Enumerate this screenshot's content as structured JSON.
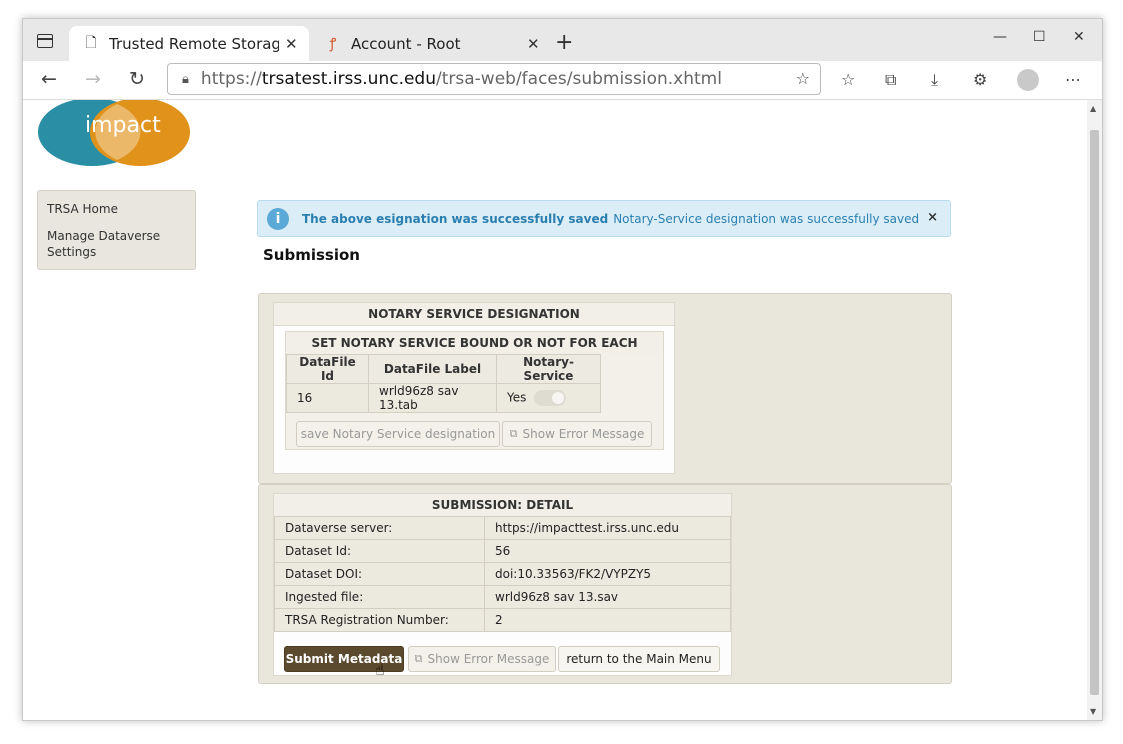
{
  "browser": {
    "tabs": [
      {
        "title": "Trusted Remote Storage A",
        "icon": "page-icon"
      },
      {
        "title": "Account - Root",
        "icon": "ubuntu-sso-icon"
      }
    ],
    "url_prefix": "https://",
    "url_domain": "trsatest.irss.unc.edu",
    "url_path": "/trsa-web/faces/submission.xhtml"
  },
  "logo": {
    "text": "impact"
  },
  "sidebar": {
    "items": [
      {
        "label": "TRSA Home"
      },
      {
        "label": "Manage Dataverse Settings"
      }
    ]
  },
  "message": {
    "summary": "The above esignation was successfully saved",
    "detail": "Notary-Service designation was successfully saved",
    "close": "×"
  },
  "page": {
    "title": "Submission"
  },
  "notary": {
    "title": "NOTARY SERVICE DESIGNATION",
    "subtitle": "SET NOTARY SERVICE BOUND OR NOT FOR EACH INGESTED FILE",
    "columns": [
      "DataFile Id",
      "DataFile Label",
      "Notary-Service"
    ],
    "rows": [
      {
        "id": "16",
        "label": "wrld96z8 sav 13.tab",
        "notary": "Yes"
      }
    ],
    "save_button": "save Notary Service designation",
    "error_button": "Show Error Message"
  },
  "submission": {
    "title": "SUBMISSION: DETAIL",
    "rows": [
      {
        "key": "Dataverse server:",
        "value": "https://impacttest.irss.unc.edu"
      },
      {
        "key": "Dataset Id:",
        "value": "56"
      },
      {
        "key": "Dataset DOI:",
        "value": "doi:10.33563/FK2/VYPZY5"
      },
      {
        "key": "Ingested file:",
        "value": "wrld96z8 sav 13.sav"
      },
      {
        "key": "TRSA Registration Number:",
        "value": "2"
      }
    ],
    "submit_button": "Submit Metadata",
    "error_button": "Show Error Message",
    "return_button": "return to the Main Menu"
  },
  "colors": {
    "accent": "#2b7fb0",
    "submit": "#5b4a2e",
    "logo_teal": "#2a8fa5",
    "logo_orange": "#e0921a"
  }
}
